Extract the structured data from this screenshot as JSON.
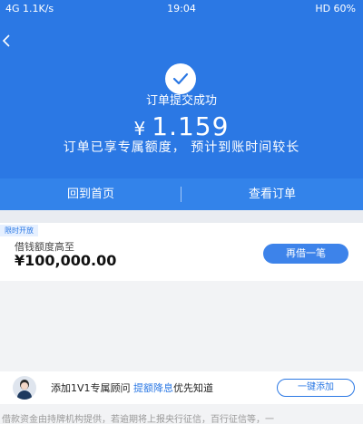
{
  "status_bar": {
    "left": "4G 1.1K/s",
    "time": "19:04",
    "right": "HD 60%"
  },
  "header": {
    "back_icon": "chevron-left-icon",
    "check_icon": "check-icon",
    "status_title": "订单提交成功",
    "currency": "¥",
    "amount": "1.159",
    "hint": "订单已享专属额度， 预计到账时间较长"
  },
  "actions": {
    "home_label": "回到首页",
    "order_label": "查看订单"
  },
  "limit_card": {
    "tag": "限时开放",
    "label": "借钱额度高至",
    "amount": "¥100,000.00",
    "button": "再借一笔"
  },
  "advisor": {
    "text_prefix": "添加1V1专属顾问 ",
    "text_highlight": "提额降息",
    "text_suffix": "优先知道",
    "button": "一键添加"
  },
  "disclaimer": "借款资金由持牌机构提供，若逾期将上报央行征信，百行征信等，一",
  "colors": {
    "brand_blue": "#2b78e4",
    "action_bar": "#3383ea"
  }
}
